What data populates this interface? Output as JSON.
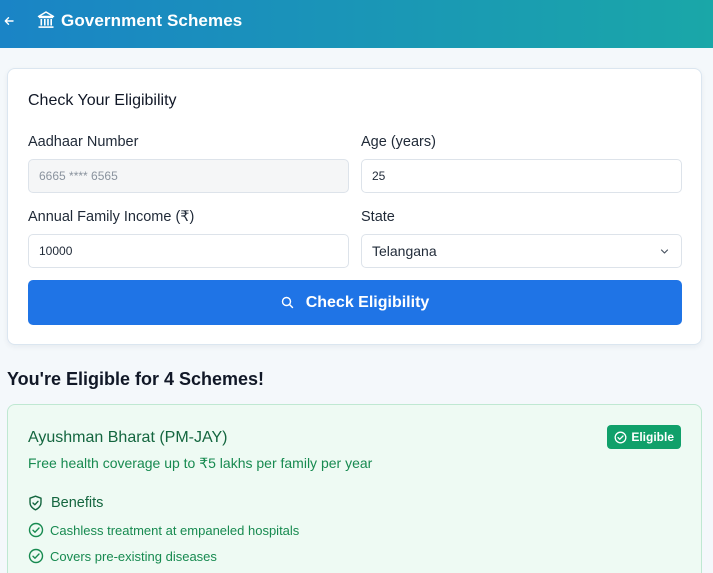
{
  "header": {
    "back_icon": "arrow-left-icon",
    "brand_icon": "bank-icon",
    "title": "Government Schemes"
  },
  "form": {
    "title": "Check Your Eligibility",
    "aadhaar": {
      "label": "Aadhaar Number",
      "value": "6665 **** 6565"
    },
    "age": {
      "label": "Age (years)",
      "value": "25"
    },
    "income": {
      "label": "Annual Family Income (₹)",
      "value": "10000"
    },
    "state": {
      "label": "State",
      "value": "Telangana"
    },
    "submit_label": "Check Eligibility"
  },
  "results": {
    "heading": "You're Eligible for 4 Schemes!",
    "schemes": [
      {
        "name": "Ayushman Bharat (PM-JAY)",
        "description": "Free health coverage up to ₹5 lakhs per family per year",
        "badge": "Eligible",
        "benefits_title": "Benefits",
        "benefits": [
          "Cashless treatment at empaneled hospitals",
          "Covers pre-existing diseases"
        ]
      }
    ]
  },
  "colors": {
    "header_start": "#1a84c6",
    "header_end": "#1aa7a8",
    "primary_button": "#1f74e6",
    "eligible_badge": "#10a06a",
    "scheme_card_bg": "#eefaf3",
    "scheme_text": "#178a50"
  }
}
